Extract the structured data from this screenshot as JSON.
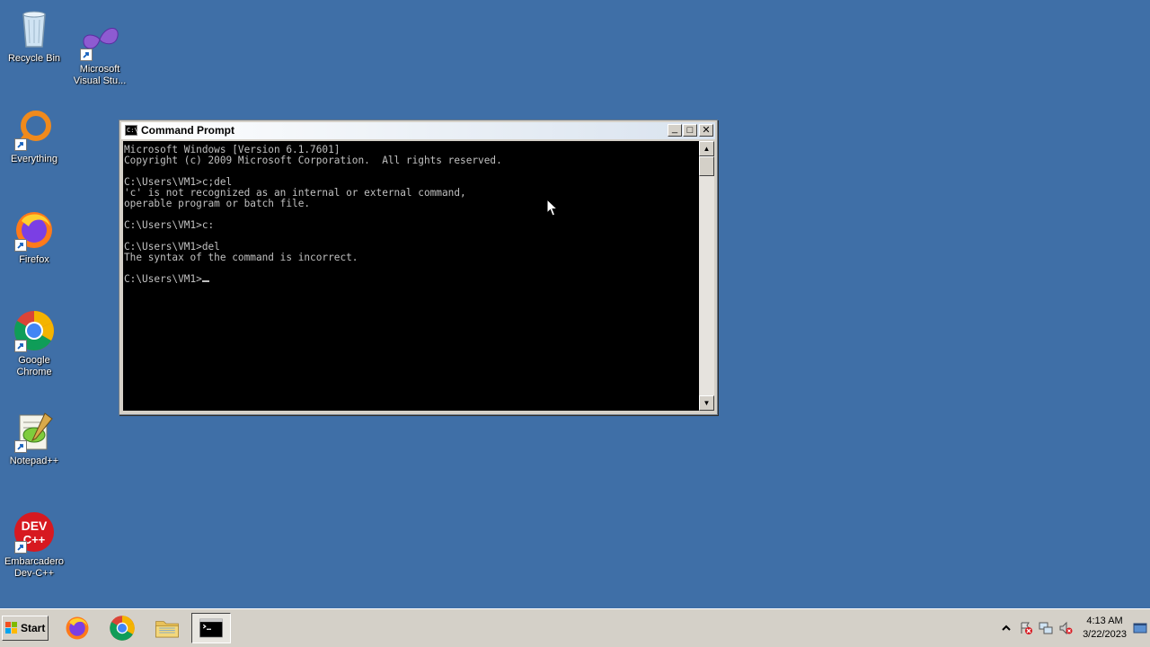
{
  "desktop": {
    "icons": [
      {
        "label": "Recycle Bin",
        "icon": "recycle-bin-icon"
      },
      {
        "label": "Microsoft\nVisual Stu...",
        "icon": "visual-studio-icon"
      },
      {
        "label": "Everything",
        "icon": "everything-search-icon"
      },
      {
        "label": "Firefox",
        "icon": "firefox-icon"
      },
      {
        "label": "Google\nChrome",
        "icon": "chrome-icon"
      },
      {
        "label": "Notepad++",
        "icon": "notepad-plus-plus-icon"
      },
      {
        "label": "Embarcadero\nDev-C++",
        "icon": "dev-cpp-icon"
      }
    ]
  },
  "cmd_window": {
    "title": "Command Prompt",
    "icon_glyph": "C:\\",
    "minimize_glyph": "_",
    "maximize_glyph": "□",
    "close_glyph": "✕",
    "console_lines": [
      "Microsoft Windows [Version 6.1.7601]",
      "Copyright (c) 2009 Microsoft Corporation.  All rights reserved.",
      "",
      "C:\\Users\\VM1>c;del",
      "'c' is not recognized as an internal or external command,",
      "operable program or batch file.",
      "",
      "C:\\Users\\VM1>c:",
      "",
      "C:\\Users\\VM1>del",
      "The syntax of the command is incorrect.",
      ""
    ],
    "prompt": "C:\\Users\\VM1>",
    "scroll_up_glyph": "▲",
    "scroll_down_glyph": "▼",
    "console_bg": "#000000",
    "console_fg": "#c0c0c0"
  },
  "taskbar": {
    "start_label": "Start",
    "apps": [
      {
        "name": "firefox",
        "icon": "firefox-icon"
      },
      {
        "name": "chrome",
        "icon": "chrome-icon"
      },
      {
        "name": "file-explorer",
        "icon": "folder-icon"
      },
      {
        "name": "command-prompt",
        "icon": "cmd-icon",
        "active": true
      }
    ],
    "clock": {
      "time": "4:13 AM",
      "date": "3/22/2023"
    },
    "tray_icons": [
      "chevron-up-icon",
      "action-center-icon",
      "network-icon",
      "volume-muted-icon",
      "show-desktop-icon"
    ]
  },
  "colors": {
    "desktop": "#3f6fa7",
    "taskbar": "#d4d0c8"
  }
}
